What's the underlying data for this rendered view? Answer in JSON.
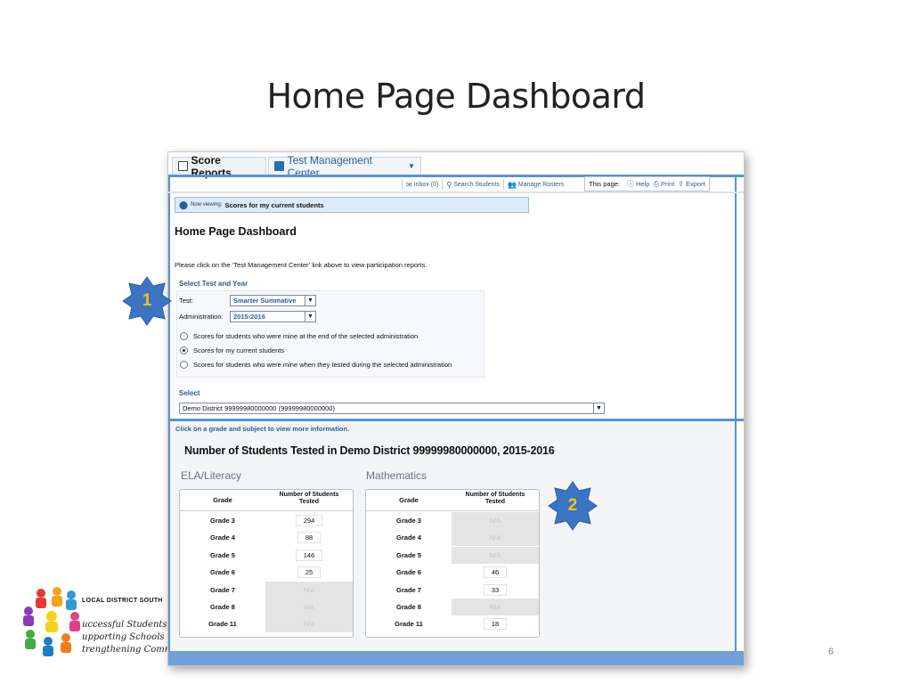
{
  "slide": {
    "title": "Home Page Dashboard",
    "page_number": "6",
    "logo": {
      "org": "LOCAL DISTRICT SOUTH",
      "lines": [
        "uccessful Students,",
        "upporting Schools &",
        "trengthening Commu"
      ]
    }
  },
  "callouts": [
    {
      "label": "1",
      "color": "#3b74c2"
    },
    {
      "label": "2",
      "color": "#3b74c2"
    }
  ],
  "app": {
    "tabs": [
      {
        "label": "Score Reports",
        "icon": "report-icon"
      },
      {
        "label": "Test Management Center",
        "icon": "tmc-icon"
      }
    ],
    "toolbar": {
      "inbox": "Inbox (0)",
      "search_students": "Search Students",
      "manage_rosters": "Manage Rosters",
      "this_page": "This page:",
      "help": "Help",
      "print": "Print",
      "export": "Export"
    },
    "now_viewing": {
      "prefix": "Now viewing:",
      "value": "Scores for my current students"
    },
    "heading": "Home Page Dashboard",
    "instruction": "Please click on the ‘Test Management Center’ link above to view participation reports.",
    "select_test": {
      "heading": "Select Test and Year",
      "test_label": "Test:",
      "test_value": "Smarter Summative",
      "admin_label": "Administration:",
      "admin_value": "2015-2016",
      "radios": [
        {
          "label": "Scores for students who were mine at the end of the selected administration",
          "checked": false
        },
        {
          "label": "Scores for my current students",
          "checked": true
        },
        {
          "label": "Scores for students who were mine when they tested during the selected administration",
          "checked": false
        }
      ]
    },
    "select": {
      "heading": "Select",
      "value": "Demo District 99999980000000 (99999980000000)"
    },
    "click_hint": "Click on a grade and subject to view more information.",
    "students_title": "Number of Students Tested in Demo District 99999980000000, 2015-2016",
    "tables": [
      {
        "subject": "ELA/Literacy",
        "col_grade": "Grade",
        "col_num_1": "Number of Students",
        "col_num_2": "Tested",
        "rows": [
          {
            "grade": "Grade 3",
            "value": "294",
            "na": false
          },
          {
            "grade": "Grade 4",
            "value": "88",
            "na": false
          },
          {
            "grade": "Grade 5",
            "value": "146",
            "na": false
          },
          {
            "grade": "Grade 6",
            "value": "25",
            "na": false
          },
          {
            "grade": "Grade 7",
            "value": "N/A",
            "na": true
          },
          {
            "grade": "Grade 8",
            "value": "N/A",
            "na": true
          },
          {
            "grade": "Grade 11",
            "value": "N/A",
            "na": true
          }
        ]
      },
      {
        "subject": "Mathematics",
        "col_grade": "Grade",
        "col_num_1": "Number of Students",
        "col_num_2": "Tested",
        "rows": [
          {
            "grade": "Grade 3",
            "value": "N/A",
            "na": true
          },
          {
            "grade": "Grade 4",
            "value": "N/A",
            "na": true
          },
          {
            "grade": "Grade 5",
            "value": "N/A",
            "na": true
          },
          {
            "grade": "Grade 6",
            "value": "46",
            "na": false
          },
          {
            "grade": "Grade 7",
            "value": "33",
            "na": false
          },
          {
            "grade": "Grade 8",
            "value": "N/A",
            "na": true
          },
          {
            "grade": "Grade 11",
            "value": "18",
            "na": false
          }
        ]
      }
    ]
  }
}
